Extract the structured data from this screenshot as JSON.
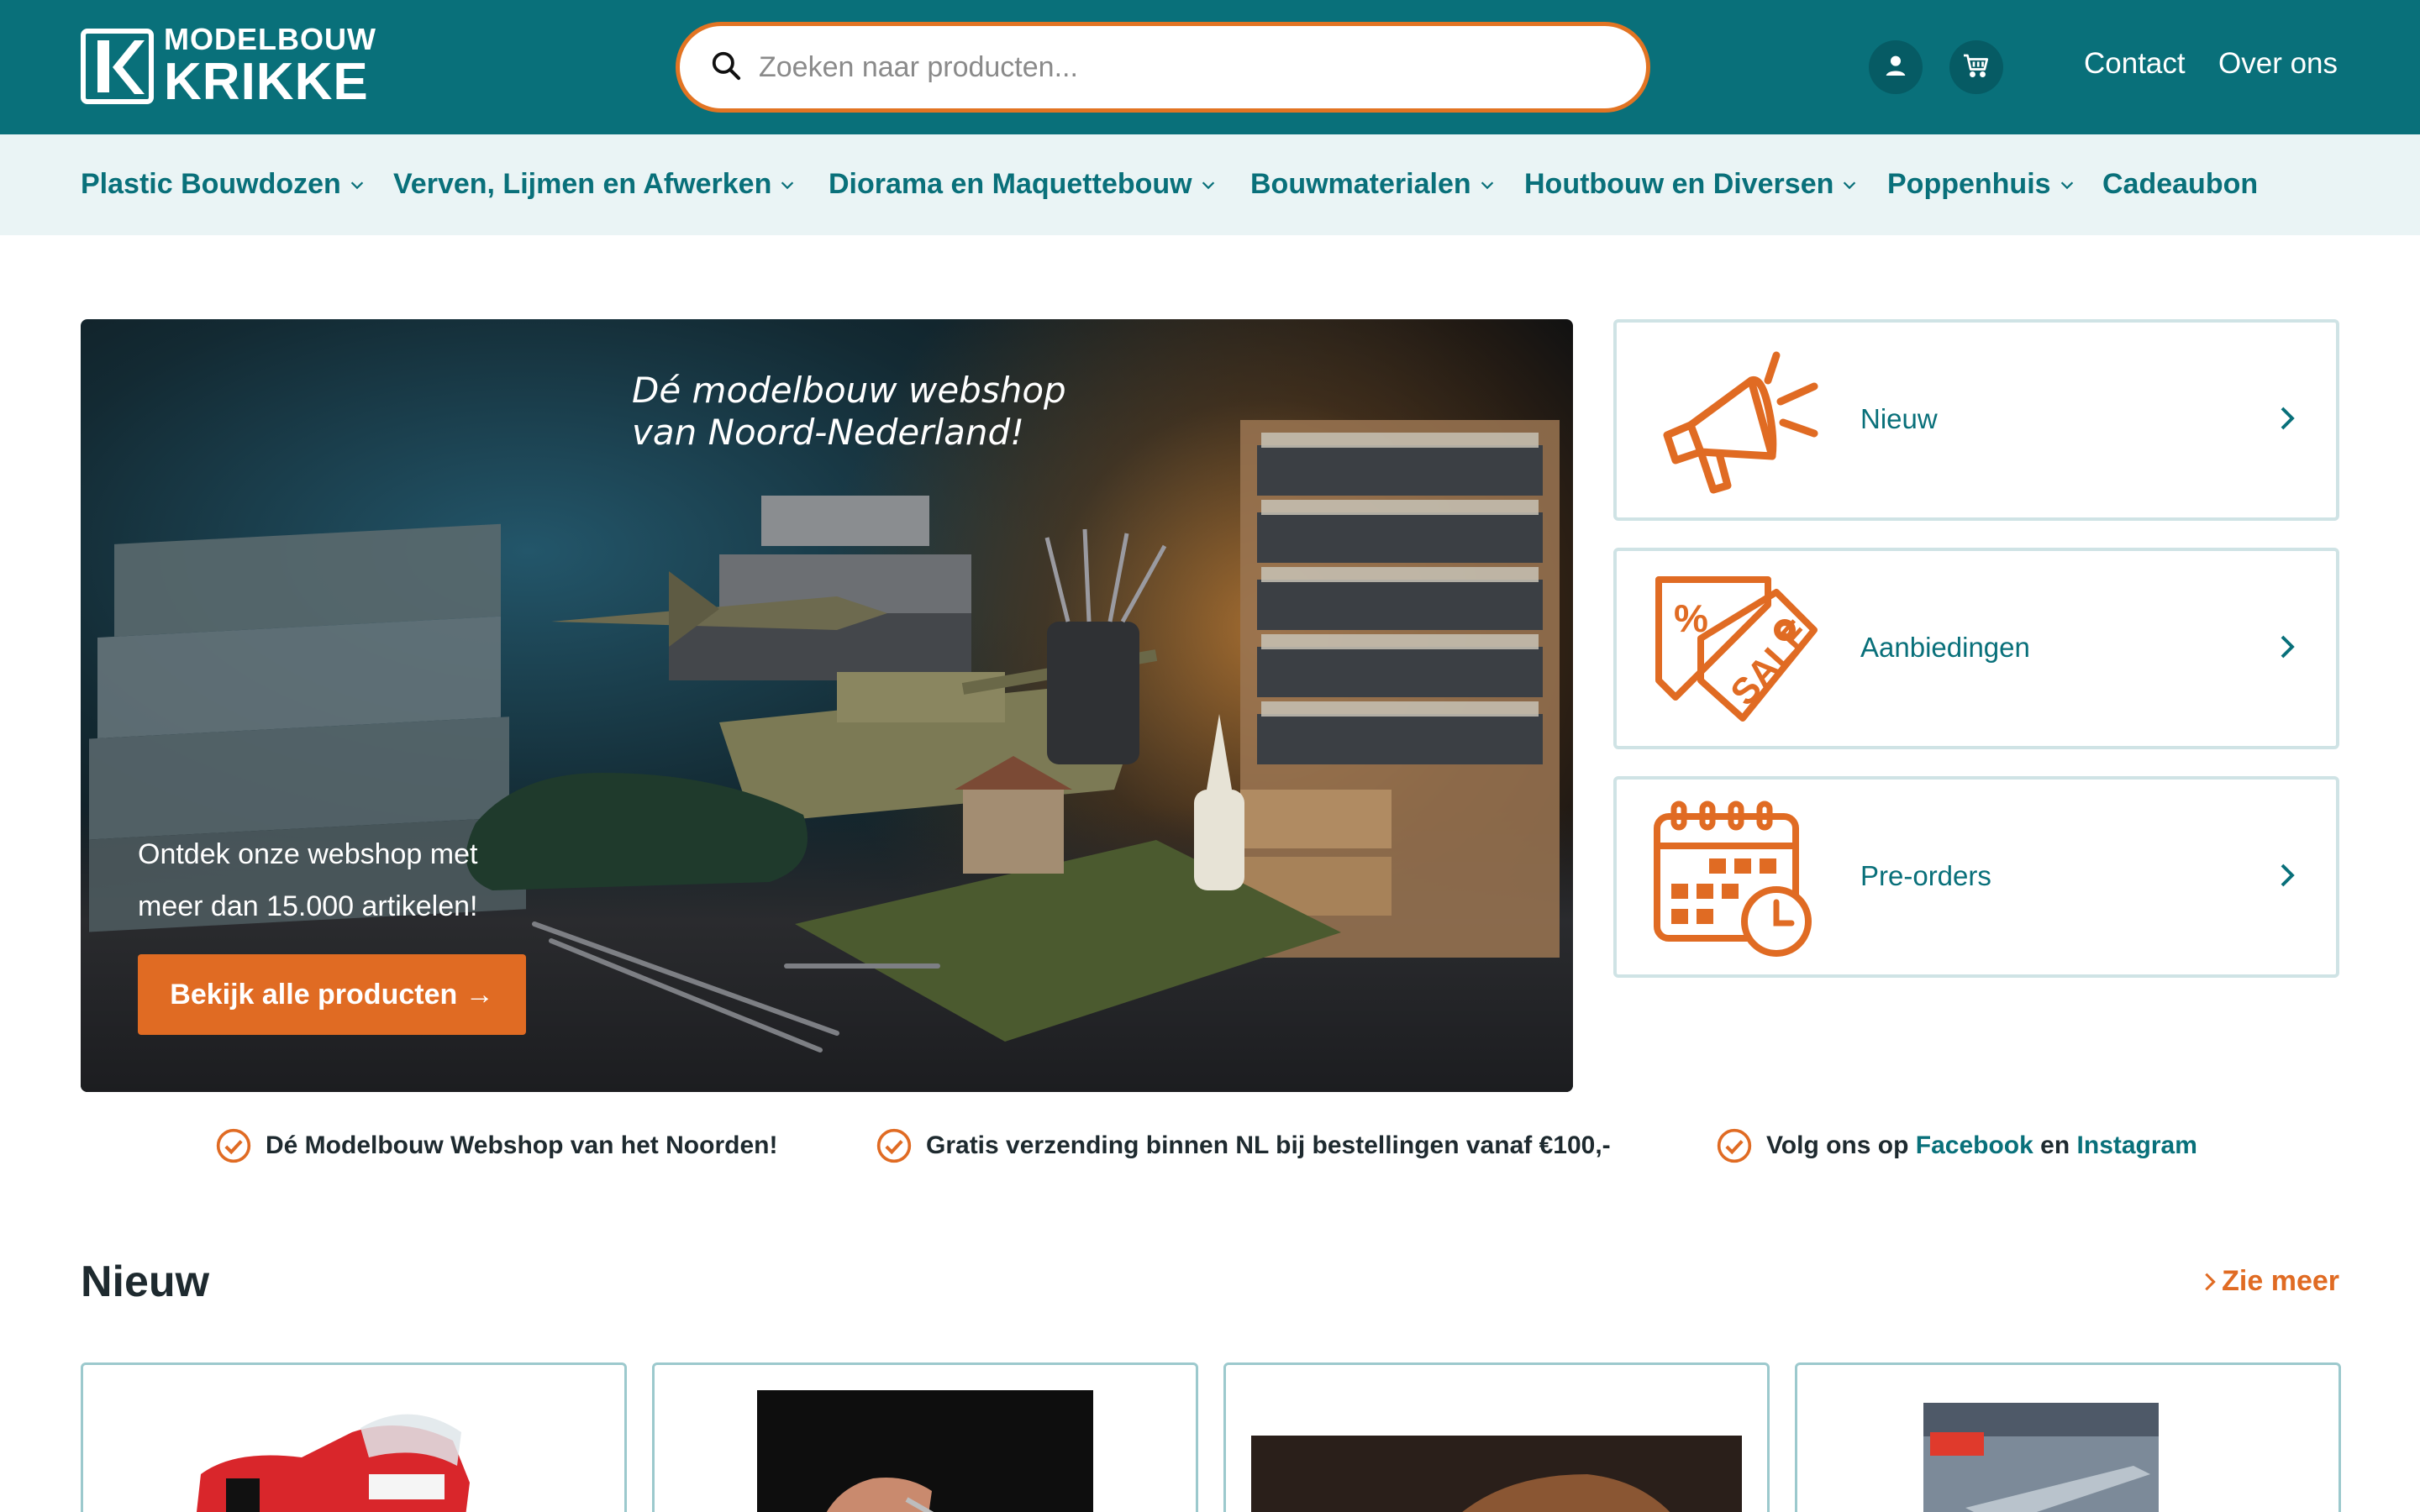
{
  "brand": {
    "line1": "MODELBOUW",
    "line2": "KRIKKE"
  },
  "search": {
    "placeholder": "Zoeken naar producten..."
  },
  "header_links": [
    "Contact",
    "Over ons"
  ],
  "nav": [
    {
      "label": "Plastic Bouwdozen",
      "dropdown": true
    },
    {
      "label": "Verven, Lijmen en Afwerken",
      "dropdown": true
    },
    {
      "label": "Diorama en Maquettebouw",
      "dropdown": true
    },
    {
      "label": "Bouwmaterialen",
      "dropdown": true
    },
    {
      "label": "Houtbouw en Diversen",
      "dropdown": true
    },
    {
      "label": "Poppenhuis",
      "dropdown": true
    },
    {
      "label": "Cadeaubon",
      "dropdown": false
    }
  ],
  "hero": {
    "tagline_1": "Dé modelbouw webshop",
    "tagline_2": "van Noord-Nederland!",
    "subtitle_1": "Ontdek onze webshop met",
    "subtitle_2": "meer dan 15.000 artikelen!",
    "button": "Bekijk alle producten →"
  },
  "cards": [
    {
      "label": "Nieuw",
      "icon": "megaphone-icon"
    },
    {
      "label": "Aanbiedingen",
      "icon": "sale-tag-icon"
    },
    {
      "label": "Pre-orders",
      "icon": "calendar-clock-icon"
    }
  ],
  "usps": {
    "item1": "Dé Modelbouw Webshop van het Noorden!",
    "item2": "Gratis verzending binnen NL bij bestellingen vanaf €100,-",
    "item3_prefix": "Volg ons op",
    "item3_link1": "Facebook",
    "item3_mid": "en",
    "item3_link2": "Instagram"
  },
  "section": {
    "title": "Nieuw",
    "see_more": "Zie meer"
  },
  "colors": {
    "primary": "#09707a",
    "accent": "#e06b23",
    "nav_bg": "#eaf4f5"
  }
}
